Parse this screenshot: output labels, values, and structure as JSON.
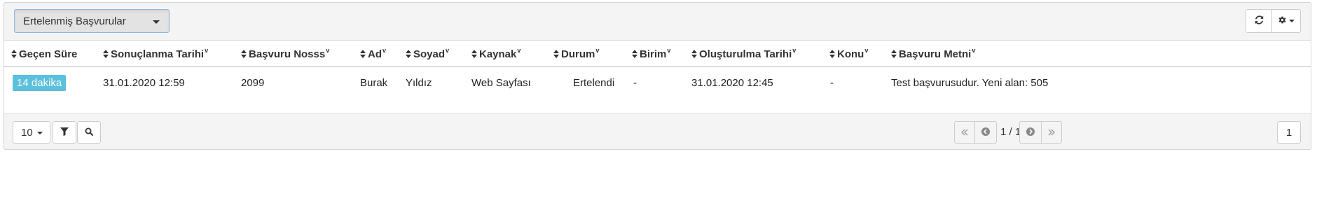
{
  "toolbar": {
    "view_selector": "Ertelenmiş Başvurular",
    "refresh_icon": "refresh-icon",
    "settings_icon": "gear-icon"
  },
  "table": {
    "columns": [
      {
        "label": "Geçen Süre",
        "filter": ""
      },
      {
        "label": "Sonuçlanma Tarihi",
        "filter": "v"
      },
      {
        "label": "Başvuru Nosss",
        "filter": "v"
      },
      {
        "label": "Ad",
        "filter": "v"
      },
      {
        "label": "Soyad",
        "filter": "v"
      },
      {
        "label": "Kaynak",
        "filter": "v"
      },
      {
        "label": "Durum",
        "filter": "v"
      },
      {
        "label": "Birim",
        "filter": "v"
      },
      {
        "label": "Oluşturulma Tarihi",
        "filter": "v"
      },
      {
        "label": "Konu",
        "filter": "v"
      },
      {
        "label": "Başvuru Metni",
        "filter": "v"
      }
    ],
    "rows": [
      {
        "elapsed": "14 dakika",
        "result_date": "31.01.2020 12:59",
        "application_no": "2099",
        "first_name": "Burak",
        "last_name": "Yıldız",
        "source": "Web Sayfası",
        "status": "Ertelendi",
        "unit": "-",
        "created_date": "31.01.2020 12:45",
        "subject": "-",
        "text": "Test başvurusudur. Yeni alan: 505"
      }
    ]
  },
  "footer": {
    "page_size": "10",
    "page_info": "1 / 1",
    "page_input": "1"
  },
  "colors": {
    "badge": "#5bc0de",
    "panel_bg": "#f4f4f4",
    "select_border": "#8fb8e0"
  }
}
